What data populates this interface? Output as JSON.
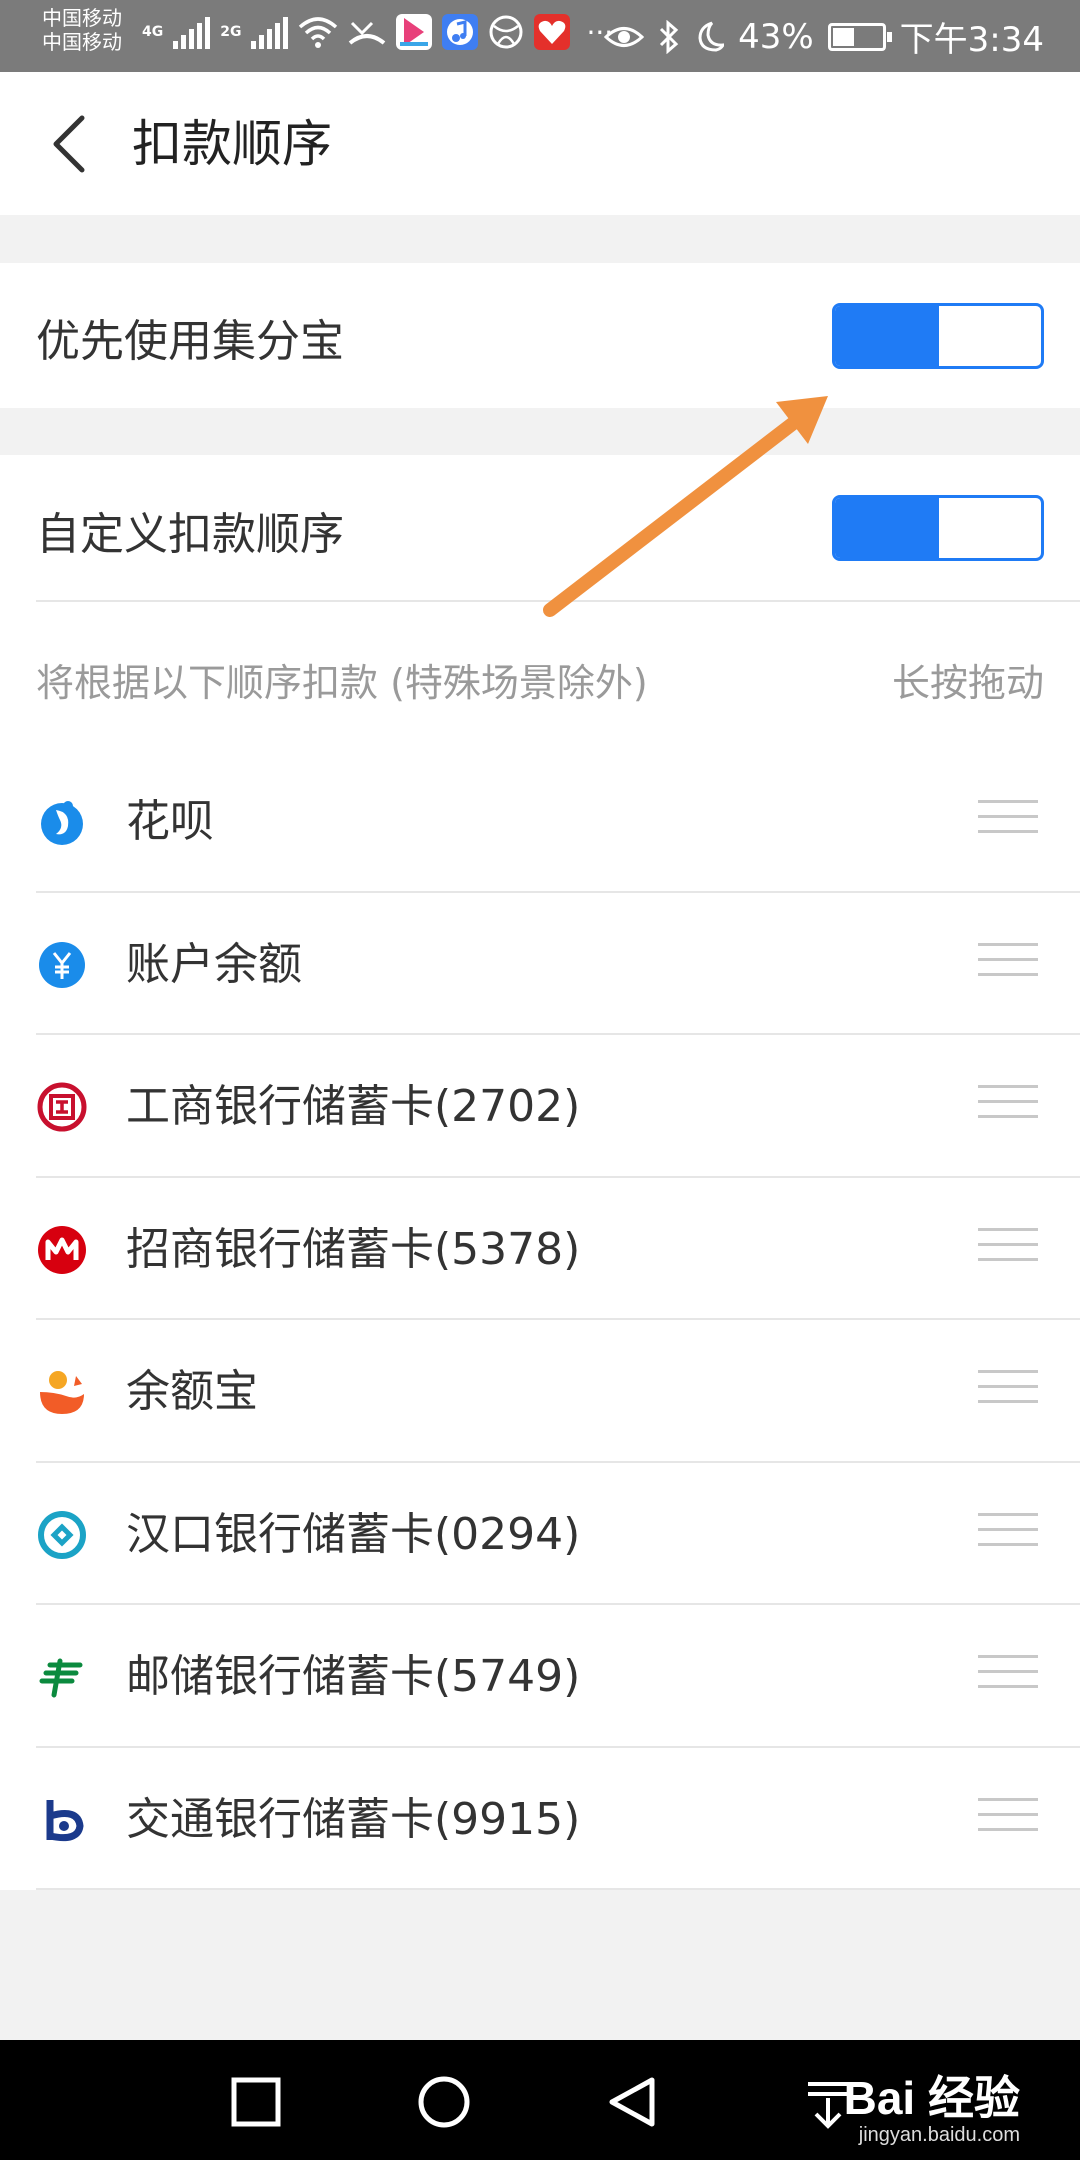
{
  "status_bar": {
    "carrier_1": "中国移动",
    "carrier_2": "中国移动",
    "net_1": "4G",
    "net_2": "2G",
    "battery": "43%",
    "time": "下午3:34"
  },
  "header": {
    "title": "扣款顺序"
  },
  "settings": {
    "prefer_label": "优先使用集分宝",
    "prefer_on": true,
    "custom_label": "自定义扣款顺序",
    "custom_on": true
  },
  "hint": {
    "left": "将根据以下顺序扣款 (特殊场景除外)",
    "right": "长按拖动"
  },
  "methods": [
    {
      "label": "花呗",
      "icon": "huabei-icon",
      "color": "#1a8cea"
    },
    {
      "label": "账户余额",
      "icon": "balance-icon",
      "color": "#1a8cea"
    },
    {
      "label": "工商银行储蓄卡(2702)",
      "icon": "icbc-icon",
      "color": "#c8102e"
    },
    {
      "label": "招商银行储蓄卡(5378)",
      "icon": "cmb-icon",
      "color": "#d7000f"
    },
    {
      "label": "余额宝",
      "icon": "yuebao-icon",
      "color": "#f25c27"
    },
    {
      "label": "汉口银行储蓄卡(0294)",
      "icon": "hankou-bank-icon",
      "color": "#1ba3c6"
    },
    {
      "label": "邮储银行储蓄卡(5749)",
      "icon": "psbc-icon",
      "color": "#0b8a3e"
    },
    {
      "label": "交通银行储蓄卡(9915)",
      "icon": "bocom-icon",
      "color": "#1b3a8c"
    }
  ],
  "watermark": {
    "brand": "Bai 经验",
    "url": "jingyan.baidu.com"
  },
  "colors": {
    "accent": "#1f7bf5",
    "annotation_arrow": "#f0913f"
  }
}
